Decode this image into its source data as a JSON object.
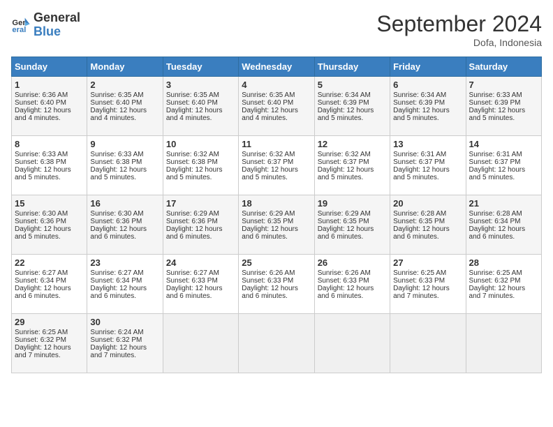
{
  "logo": {
    "line1": "General",
    "line2": "Blue"
  },
  "title": "September 2024",
  "subtitle": "Dofa, Indonesia",
  "days_of_week": [
    "Sunday",
    "Monday",
    "Tuesday",
    "Wednesday",
    "Thursday",
    "Friday",
    "Saturday"
  ],
  "weeks": [
    [
      {
        "day": "1",
        "lines": [
          "Sunrise: 6:36 AM",
          "Sunset: 6:40 PM",
          "Daylight: 12 hours",
          "and 4 minutes."
        ]
      },
      {
        "day": "2",
        "lines": [
          "Sunrise: 6:35 AM",
          "Sunset: 6:40 PM",
          "Daylight: 12 hours",
          "and 4 minutes."
        ]
      },
      {
        "day": "3",
        "lines": [
          "Sunrise: 6:35 AM",
          "Sunset: 6:40 PM",
          "Daylight: 12 hours",
          "and 4 minutes."
        ]
      },
      {
        "day": "4",
        "lines": [
          "Sunrise: 6:35 AM",
          "Sunset: 6:40 PM",
          "Daylight: 12 hours",
          "and 4 minutes."
        ]
      },
      {
        "day": "5",
        "lines": [
          "Sunrise: 6:34 AM",
          "Sunset: 6:39 PM",
          "Daylight: 12 hours",
          "and 5 minutes."
        ]
      },
      {
        "day": "6",
        "lines": [
          "Sunrise: 6:34 AM",
          "Sunset: 6:39 PM",
          "Daylight: 12 hours",
          "and 5 minutes."
        ]
      },
      {
        "day": "7",
        "lines": [
          "Sunrise: 6:33 AM",
          "Sunset: 6:39 PM",
          "Daylight: 12 hours",
          "and 5 minutes."
        ]
      }
    ],
    [
      {
        "day": "8",
        "lines": [
          "Sunrise: 6:33 AM",
          "Sunset: 6:38 PM",
          "Daylight: 12 hours",
          "and 5 minutes."
        ]
      },
      {
        "day": "9",
        "lines": [
          "Sunrise: 6:33 AM",
          "Sunset: 6:38 PM",
          "Daylight: 12 hours",
          "and 5 minutes."
        ]
      },
      {
        "day": "10",
        "lines": [
          "Sunrise: 6:32 AM",
          "Sunset: 6:38 PM",
          "Daylight: 12 hours",
          "and 5 minutes."
        ]
      },
      {
        "day": "11",
        "lines": [
          "Sunrise: 6:32 AM",
          "Sunset: 6:37 PM",
          "Daylight: 12 hours",
          "and 5 minutes."
        ]
      },
      {
        "day": "12",
        "lines": [
          "Sunrise: 6:32 AM",
          "Sunset: 6:37 PM",
          "Daylight: 12 hours",
          "and 5 minutes."
        ]
      },
      {
        "day": "13",
        "lines": [
          "Sunrise: 6:31 AM",
          "Sunset: 6:37 PM",
          "Daylight: 12 hours",
          "and 5 minutes."
        ]
      },
      {
        "day": "14",
        "lines": [
          "Sunrise: 6:31 AM",
          "Sunset: 6:37 PM",
          "Daylight: 12 hours",
          "and 5 minutes."
        ]
      }
    ],
    [
      {
        "day": "15",
        "lines": [
          "Sunrise: 6:30 AM",
          "Sunset: 6:36 PM",
          "Daylight: 12 hours",
          "and 5 minutes."
        ]
      },
      {
        "day": "16",
        "lines": [
          "Sunrise: 6:30 AM",
          "Sunset: 6:36 PM",
          "Daylight: 12 hours",
          "and 6 minutes."
        ]
      },
      {
        "day": "17",
        "lines": [
          "Sunrise: 6:29 AM",
          "Sunset: 6:36 PM",
          "Daylight: 12 hours",
          "and 6 minutes."
        ]
      },
      {
        "day": "18",
        "lines": [
          "Sunrise: 6:29 AM",
          "Sunset: 6:35 PM",
          "Daylight: 12 hours",
          "and 6 minutes."
        ]
      },
      {
        "day": "19",
        "lines": [
          "Sunrise: 6:29 AM",
          "Sunset: 6:35 PM",
          "Daylight: 12 hours",
          "and 6 minutes."
        ]
      },
      {
        "day": "20",
        "lines": [
          "Sunrise: 6:28 AM",
          "Sunset: 6:35 PM",
          "Daylight: 12 hours",
          "and 6 minutes."
        ]
      },
      {
        "day": "21",
        "lines": [
          "Sunrise: 6:28 AM",
          "Sunset: 6:34 PM",
          "Daylight: 12 hours",
          "and 6 minutes."
        ]
      }
    ],
    [
      {
        "day": "22",
        "lines": [
          "Sunrise: 6:27 AM",
          "Sunset: 6:34 PM",
          "Daylight: 12 hours",
          "and 6 minutes."
        ]
      },
      {
        "day": "23",
        "lines": [
          "Sunrise: 6:27 AM",
          "Sunset: 6:34 PM",
          "Daylight: 12 hours",
          "and 6 minutes."
        ]
      },
      {
        "day": "24",
        "lines": [
          "Sunrise: 6:27 AM",
          "Sunset: 6:33 PM",
          "Daylight: 12 hours",
          "and 6 minutes."
        ]
      },
      {
        "day": "25",
        "lines": [
          "Sunrise: 6:26 AM",
          "Sunset: 6:33 PM",
          "Daylight: 12 hours",
          "and 6 minutes."
        ]
      },
      {
        "day": "26",
        "lines": [
          "Sunrise: 6:26 AM",
          "Sunset: 6:33 PM",
          "Daylight: 12 hours",
          "and 6 minutes."
        ]
      },
      {
        "day": "27",
        "lines": [
          "Sunrise: 6:25 AM",
          "Sunset: 6:33 PM",
          "Daylight: 12 hours",
          "and 7 minutes."
        ]
      },
      {
        "day": "28",
        "lines": [
          "Sunrise: 6:25 AM",
          "Sunset: 6:32 PM",
          "Daylight: 12 hours",
          "and 7 minutes."
        ]
      }
    ],
    [
      {
        "day": "29",
        "lines": [
          "Sunrise: 6:25 AM",
          "Sunset: 6:32 PM",
          "Daylight: 12 hours",
          "and 7 minutes."
        ]
      },
      {
        "day": "30",
        "lines": [
          "Sunrise: 6:24 AM",
          "Sunset: 6:32 PM",
          "Daylight: 12 hours",
          "and 7 minutes."
        ]
      },
      null,
      null,
      null,
      null,
      null
    ]
  ]
}
